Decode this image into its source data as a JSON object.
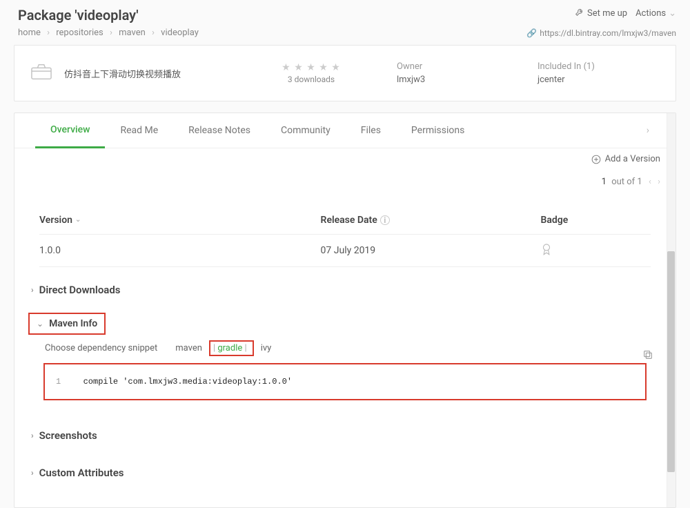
{
  "header": {
    "title": "Package 'videoplay'",
    "set_me_up": "Set me up",
    "actions_label": "Actions",
    "url": "https://dl.bintray.com/lmxjw3/maven"
  },
  "breadcrumb": [
    "home",
    "repositories",
    "maven",
    "videoplay"
  ],
  "summary": {
    "description": "仿抖音上下滑动切换视频播放",
    "downloads": "3 downloads",
    "owner_label": "Owner",
    "owner_value": "lmxjw3",
    "included_label": "Included In (1)",
    "included_value": "jcenter",
    "repo_logo": "m"
  },
  "tabs": [
    "Overview",
    "Read Me",
    "Release Notes",
    "Community",
    "Files",
    "Permissions"
  ],
  "add_version": "Add a Version",
  "pager": {
    "current": "1",
    "text": "out of 1"
  },
  "version_table": {
    "headers": {
      "version": "Version",
      "release_date": "Release Date",
      "badge": "Badge"
    },
    "rows": [
      {
        "version": "1.0.0",
        "release_date": "07 July 2019"
      }
    ]
  },
  "sections": {
    "direct_downloads": "Direct Downloads",
    "maven_info": "Maven Info",
    "screenshots": "Screenshots",
    "custom_attributes": "Custom Attributes"
  },
  "snippet": {
    "choose_label": "Choose dependency snippet",
    "tabs": {
      "maven": "maven",
      "gradle": "gradle",
      "ivy": "ivy"
    },
    "code": "compile 'com.lmxjw3.media:videoplay:1.0.0'"
  }
}
